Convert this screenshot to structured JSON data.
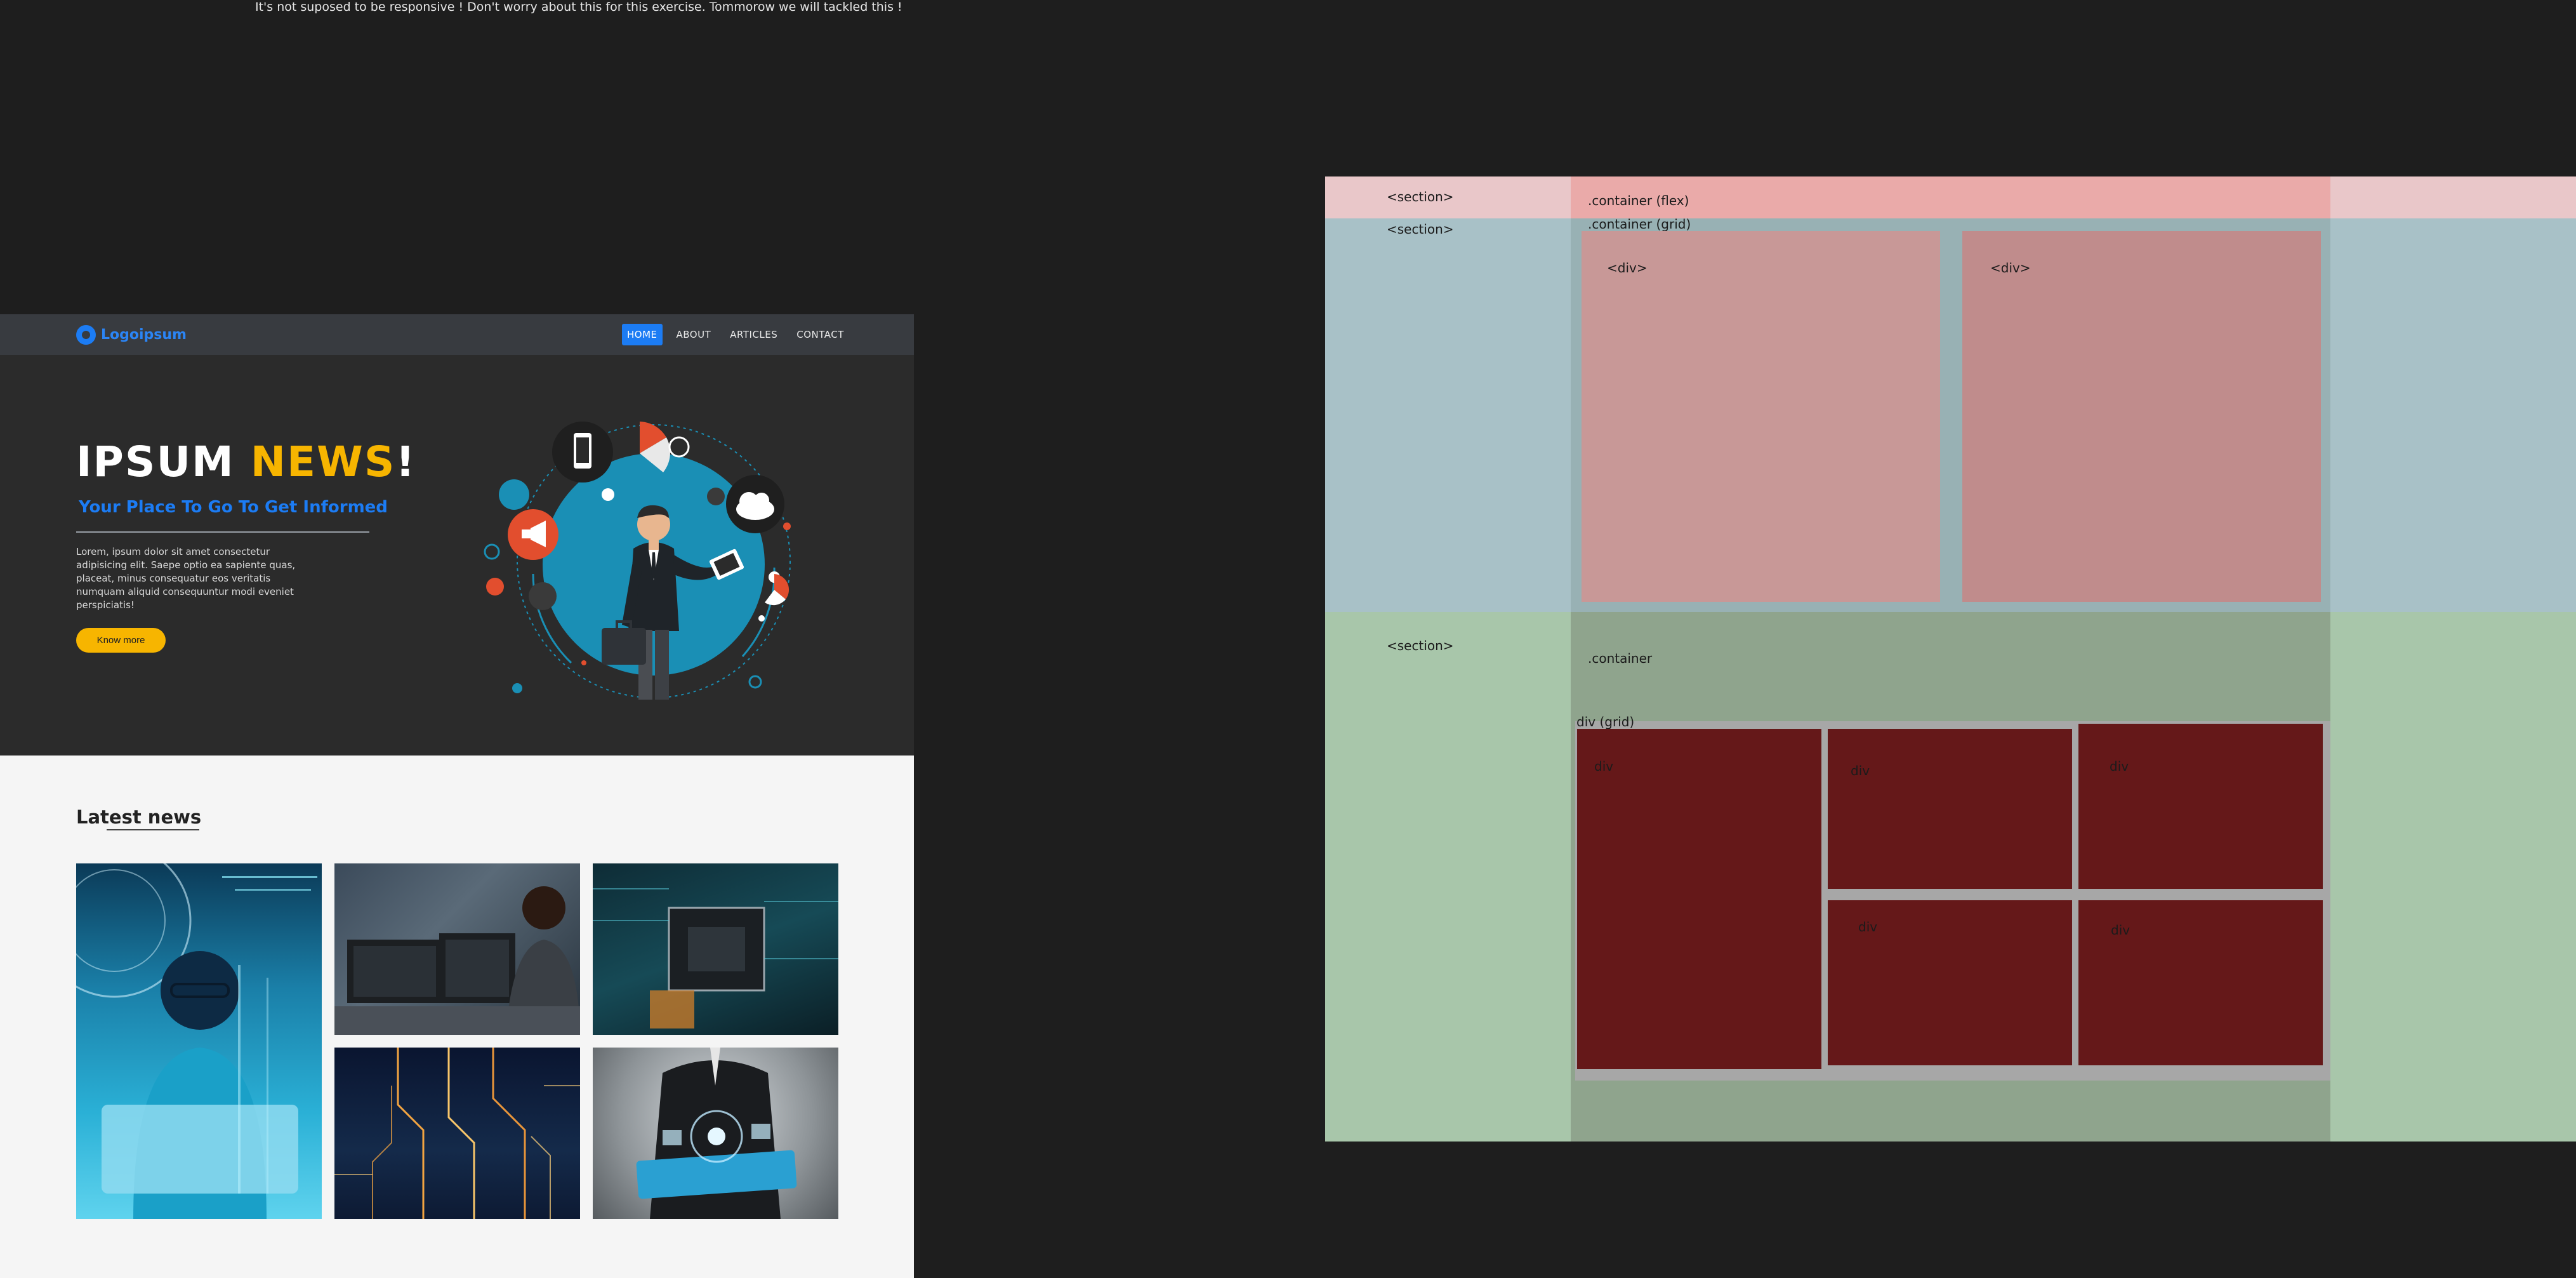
{
  "notice": "It's not suposed to be responsive ! Don't worry about this for this exercise. Tommorow we will tackled this !",
  "site": {
    "logo_text": "Logoipsum",
    "nav": [
      "HOME",
      "ABOUT",
      "ARTICLES",
      "CONTACT"
    ],
    "hero": {
      "title_main": "IPSUM ",
      "title_accent": "NEWS",
      "title_end": "!",
      "subtitle": "Your Place To Go To Get Informed",
      "text": "Lorem, ipsum dolor sit amet consectetur adipisicing elit. Saepe optio ea sapiente quas, placeat, minus consequatur eos veritatis numquam aliquid consequuntur modi eveniet perspiciatis!",
      "button": "Know more"
    },
    "news": {
      "title": "Latest news"
    }
  },
  "schema": {
    "section1_label": "<section>",
    "container_flex_label": ".container (flex)",
    "section2_label": "<section>",
    "container_grid_label": ".container (grid)",
    "div_label": "<div>",
    "section3_label": "<section>",
    "container_label": ".container",
    "div_grid_label": "div (grid)",
    "cell_label": "div"
  },
  "colors": {
    "page_bg": "#1e1e1e",
    "nav_bg": "#383b40",
    "hero_bg": "#2b2b2b",
    "brand_blue": "#1c7cf4",
    "accent_yellow": "#f7b500",
    "news_bg": "#f5f5f5"
  }
}
